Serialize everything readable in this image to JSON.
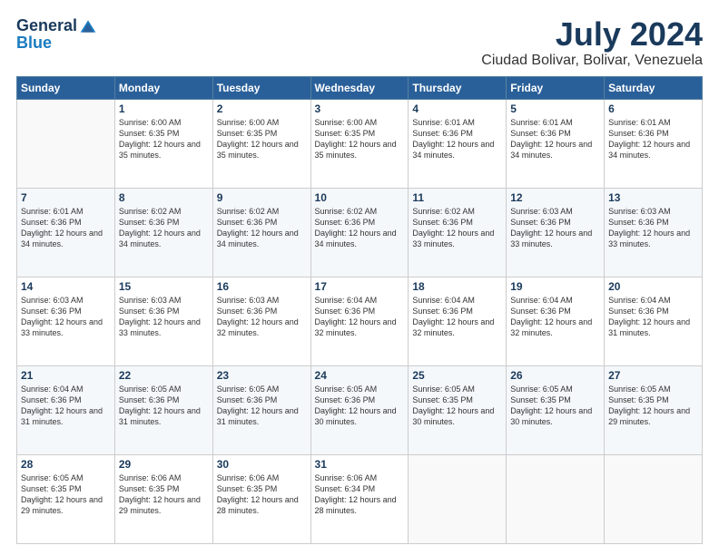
{
  "logo": {
    "general": "General",
    "blue": "Blue"
  },
  "title": "July 2024",
  "subtitle": "Ciudad Bolivar, Bolivar, Venezuela",
  "headers": [
    "Sunday",
    "Monday",
    "Tuesday",
    "Wednesday",
    "Thursday",
    "Friday",
    "Saturday"
  ],
  "weeks": [
    [
      {
        "day": "",
        "sunrise": "",
        "sunset": "",
        "daylight": ""
      },
      {
        "day": "1",
        "sunrise": "Sunrise: 6:00 AM",
        "sunset": "Sunset: 6:35 PM",
        "daylight": "Daylight: 12 hours and 35 minutes."
      },
      {
        "day": "2",
        "sunrise": "Sunrise: 6:00 AM",
        "sunset": "Sunset: 6:35 PM",
        "daylight": "Daylight: 12 hours and 35 minutes."
      },
      {
        "day": "3",
        "sunrise": "Sunrise: 6:00 AM",
        "sunset": "Sunset: 6:35 PM",
        "daylight": "Daylight: 12 hours and 35 minutes."
      },
      {
        "day": "4",
        "sunrise": "Sunrise: 6:01 AM",
        "sunset": "Sunset: 6:36 PM",
        "daylight": "Daylight: 12 hours and 34 minutes."
      },
      {
        "day": "5",
        "sunrise": "Sunrise: 6:01 AM",
        "sunset": "Sunset: 6:36 PM",
        "daylight": "Daylight: 12 hours and 34 minutes."
      },
      {
        "day": "6",
        "sunrise": "Sunrise: 6:01 AM",
        "sunset": "Sunset: 6:36 PM",
        "daylight": "Daylight: 12 hours and 34 minutes."
      }
    ],
    [
      {
        "day": "7",
        "sunrise": "Sunrise: 6:01 AM",
        "sunset": "Sunset: 6:36 PM",
        "daylight": "Daylight: 12 hours and 34 minutes."
      },
      {
        "day": "8",
        "sunrise": "Sunrise: 6:02 AM",
        "sunset": "Sunset: 6:36 PM",
        "daylight": "Daylight: 12 hours and 34 minutes."
      },
      {
        "day": "9",
        "sunrise": "Sunrise: 6:02 AM",
        "sunset": "Sunset: 6:36 PM",
        "daylight": "Daylight: 12 hours and 34 minutes."
      },
      {
        "day": "10",
        "sunrise": "Sunrise: 6:02 AM",
        "sunset": "Sunset: 6:36 PM",
        "daylight": "Daylight: 12 hours and 34 minutes."
      },
      {
        "day": "11",
        "sunrise": "Sunrise: 6:02 AM",
        "sunset": "Sunset: 6:36 PM",
        "daylight": "Daylight: 12 hours and 33 minutes."
      },
      {
        "day": "12",
        "sunrise": "Sunrise: 6:03 AM",
        "sunset": "Sunset: 6:36 PM",
        "daylight": "Daylight: 12 hours and 33 minutes."
      },
      {
        "day": "13",
        "sunrise": "Sunrise: 6:03 AM",
        "sunset": "Sunset: 6:36 PM",
        "daylight": "Daylight: 12 hours and 33 minutes."
      }
    ],
    [
      {
        "day": "14",
        "sunrise": "Sunrise: 6:03 AM",
        "sunset": "Sunset: 6:36 PM",
        "daylight": "Daylight: 12 hours and 33 minutes."
      },
      {
        "day": "15",
        "sunrise": "Sunrise: 6:03 AM",
        "sunset": "Sunset: 6:36 PM",
        "daylight": "Daylight: 12 hours and 33 minutes."
      },
      {
        "day": "16",
        "sunrise": "Sunrise: 6:03 AM",
        "sunset": "Sunset: 6:36 PM",
        "daylight": "Daylight: 12 hours and 32 minutes."
      },
      {
        "day": "17",
        "sunrise": "Sunrise: 6:04 AM",
        "sunset": "Sunset: 6:36 PM",
        "daylight": "Daylight: 12 hours and 32 minutes."
      },
      {
        "day": "18",
        "sunrise": "Sunrise: 6:04 AM",
        "sunset": "Sunset: 6:36 PM",
        "daylight": "Daylight: 12 hours and 32 minutes."
      },
      {
        "day": "19",
        "sunrise": "Sunrise: 6:04 AM",
        "sunset": "Sunset: 6:36 PM",
        "daylight": "Daylight: 12 hours and 32 minutes."
      },
      {
        "day": "20",
        "sunrise": "Sunrise: 6:04 AM",
        "sunset": "Sunset: 6:36 PM",
        "daylight": "Daylight: 12 hours and 31 minutes."
      }
    ],
    [
      {
        "day": "21",
        "sunrise": "Sunrise: 6:04 AM",
        "sunset": "Sunset: 6:36 PM",
        "daylight": "Daylight: 12 hours and 31 minutes."
      },
      {
        "day": "22",
        "sunrise": "Sunrise: 6:05 AM",
        "sunset": "Sunset: 6:36 PM",
        "daylight": "Daylight: 12 hours and 31 minutes."
      },
      {
        "day": "23",
        "sunrise": "Sunrise: 6:05 AM",
        "sunset": "Sunset: 6:36 PM",
        "daylight": "Daylight: 12 hours and 31 minutes."
      },
      {
        "day": "24",
        "sunrise": "Sunrise: 6:05 AM",
        "sunset": "Sunset: 6:36 PM",
        "daylight": "Daylight: 12 hours and 30 minutes."
      },
      {
        "day": "25",
        "sunrise": "Sunrise: 6:05 AM",
        "sunset": "Sunset: 6:35 PM",
        "daylight": "Daylight: 12 hours and 30 minutes."
      },
      {
        "day": "26",
        "sunrise": "Sunrise: 6:05 AM",
        "sunset": "Sunset: 6:35 PM",
        "daylight": "Daylight: 12 hours and 30 minutes."
      },
      {
        "day": "27",
        "sunrise": "Sunrise: 6:05 AM",
        "sunset": "Sunset: 6:35 PM",
        "daylight": "Daylight: 12 hours and 29 minutes."
      }
    ],
    [
      {
        "day": "28",
        "sunrise": "Sunrise: 6:05 AM",
        "sunset": "Sunset: 6:35 PM",
        "daylight": "Daylight: 12 hours and 29 minutes."
      },
      {
        "day": "29",
        "sunrise": "Sunrise: 6:06 AM",
        "sunset": "Sunset: 6:35 PM",
        "daylight": "Daylight: 12 hours and 29 minutes."
      },
      {
        "day": "30",
        "sunrise": "Sunrise: 6:06 AM",
        "sunset": "Sunset: 6:35 PM",
        "daylight": "Daylight: 12 hours and 28 minutes."
      },
      {
        "day": "31",
        "sunrise": "Sunrise: 6:06 AM",
        "sunset": "Sunset: 6:34 PM",
        "daylight": "Daylight: 12 hours and 28 minutes."
      },
      {
        "day": "",
        "sunrise": "",
        "sunset": "",
        "daylight": ""
      },
      {
        "day": "",
        "sunrise": "",
        "sunset": "",
        "daylight": ""
      },
      {
        "day": "",
        "sunrise": "",
        "sunset": "",
        "daylight": ""
      }
    ]
  ]
}
